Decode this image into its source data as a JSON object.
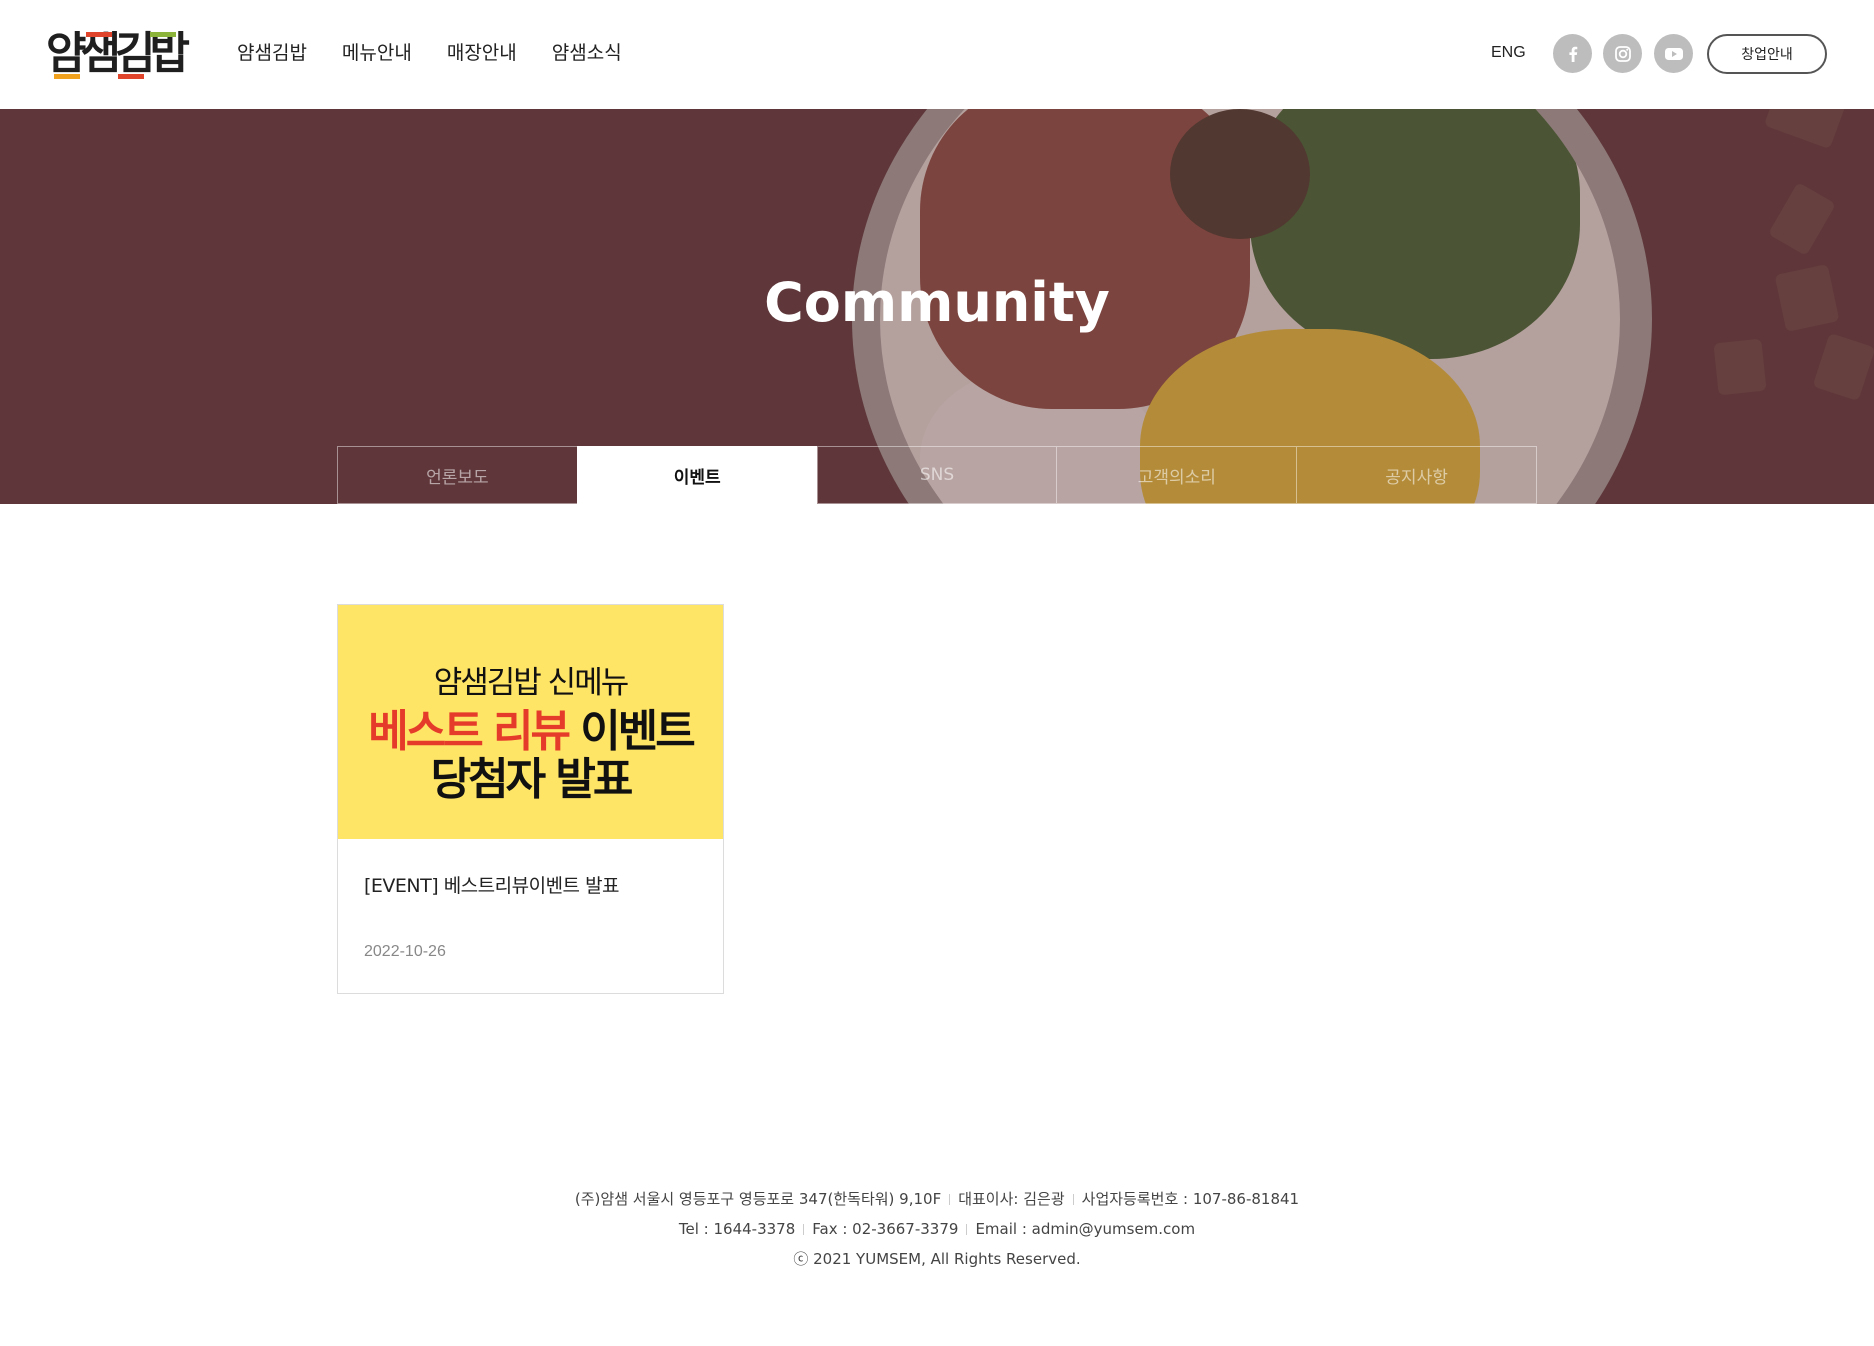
{
  "header": {
    "logo_text": "얌샘김밥",
    "nav": [
      "얌샘김밥",
      "메뉴안내",
      "매장안내",
      "얌샘소식"
    ],
    "lang": "ENG",
    "sns": [
      {
        "name": "facebook-icon",
        "glyph": "f"
      },
      {
        "name": "instagram-icon",
        "glyph": "◎"
      },
      {
        "name": "youtube-icon",
        "glyph": "▶"
      }
    ],
    "franchise_button": "창업안내"
  },
  "hero": {
    "title": "Community",
    "tabs": [
      "언론보도",
      "이벤트",
      "SNS",
      "고객의소리",
      "공지사항"
    ],
    "active_tab": "이벤트"
  },
  "events": [
    {
      "thumb_line1": "얌샘김밥 신메뉴",
      "thumb_line2_red": "베스트 리뷰",
      "thumb_line2_black": "이벤트",
      "thumb_line3": "당첨자 발표",
      "title": "[EVENT] 베스트리뷰이벤트 발표",
      "date": "2022-10-26"
    }
  ],
  "footer": {
    "line1": [
      "(주)얌샘 서울시 영등포구 영등포로 347(한독타워) 9,10F",
      "대표이사: 김은광",
      "사업자등록번호 : 107-86-81841"
    ],
    "line2": [
      "Tel : 1644-3378",
      "Fax : 02-3667-3379",
      "Email : admin@yumsem.com"
    ],
    "line3": "ⓒ 2021 YUMSEM, All Rights Reserved."
  },
  "colors": {
    "hero_bg": "#5f3a3d",
    "thumb_yellow": "#ffe566",
    "thumb_red": "#e53b2b",
    "logo_orange": "#f0a21e",
    "logo_red": "#e0442a",
    "logo_green": "#8cb33a"
  }
}
